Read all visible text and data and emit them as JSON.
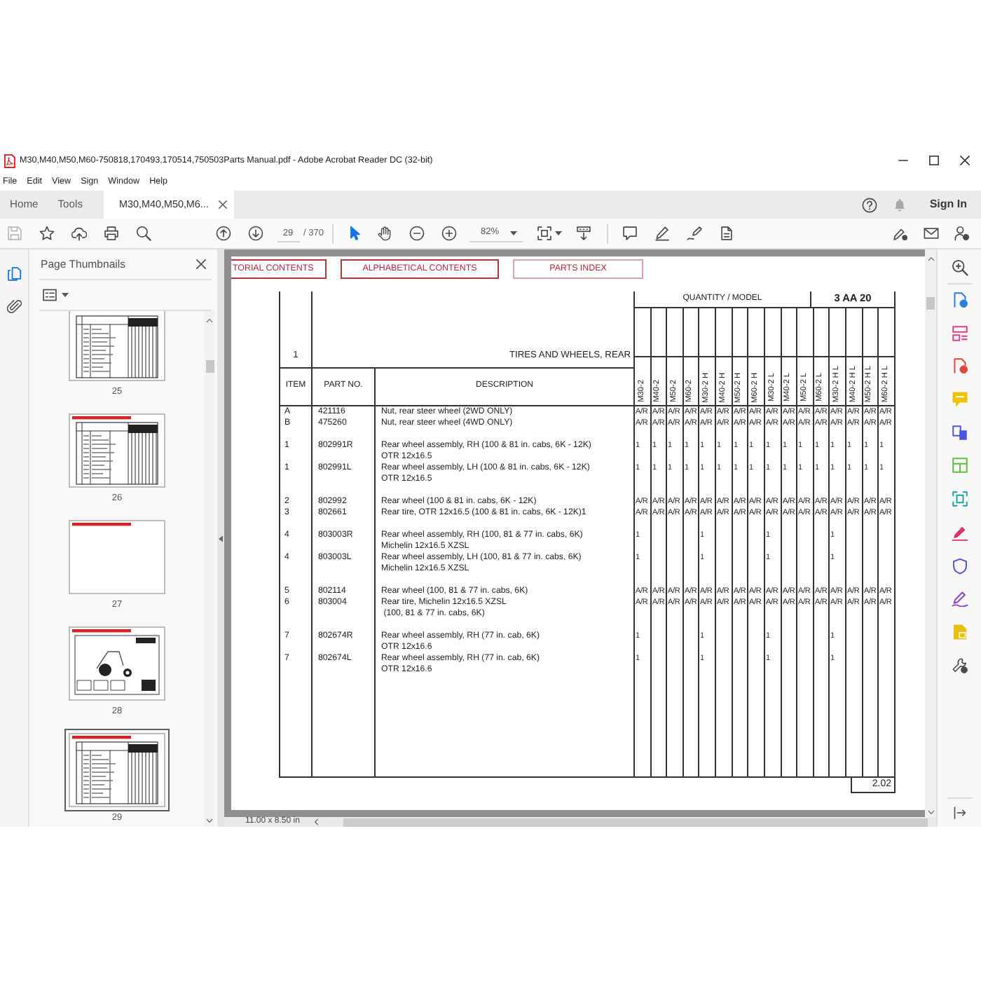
{
  "window": {
    "title": "M30,M40,M50,M60-750818,170493,170514,750503Parts Manual.pdf - Adobe Acrobat Reader DC (32-bit)"
  },
  "menu": [
    "File",
    "Edit",
    "View",
    "Sign",
    "Window",
    "Help"
  ],
  "tabs": [
    {
      "label": "Home",
      "kind": "nav",
      "selected": false
    },
    {
      "label": "Tools",
      "kind": "nav",
      "selected": false
    },
    {
      "label": "M30,M40,M50,M6...",
      "kind": "document",
      "selected": true
    }
  ],
  "account": {
    "sign_in": "Sign In"
  },
  "toolbar": {
    "page": "29",
    "page_total": "/ 370",
    "zoom": "82%"
  },
  "thumbnails_panel": {
    "title": "Page Thumbnails",
    "thumbnails": [
      {
        "label": "25",
        "kind": "table",
        "selected": false
      },
      {
        "label": "26",
        "kind": "table",
        "header_bar": true,
        "selected": false
      },
      {
        "label": "27",
        "kind": "blank",
        "header_bar": true,
        "selected": false
      },
      {
        "label": "28",
        "kind": "diagram",
        "header_bar": true,
        "selected": false
      },
      {
        "label": "29",
        "kind": "table",
        "header_bar": true,
        "selected": true
      }
    ]
  },
  "document": {
    "nav_buttons": [
      {
        "label": "TORIAL CONTENTS",
        "color": "#b5343f",
        "cut_off": true
      },
      {
        "label": "ALPHABETICAL CONTENTS",
        "color": "#b5343f",
        "cut_off": false
      },
      {
        "label": "PARTS INDEX",
        "color": "#e4a3aa",
        "cut_off": false
      }
    ],
    "parts_table": {
      "section_number": "1",
      "section_title": "TIRES AND WHEELS, REAR",
      "quantity_heading": "QUANTITY / MODEL",
      "group_code": "3 AA 20",
      "columns": [
        "ITEM",
        "PART NO.",
        "DESCRIPTION"
      ],
      "models": [
        "M30-2",
        "M40-2",
        "M50-2",
        "M60-2",
        "M30-2 H",
        "M40-2 H",
        "M50-2 H",
        "M60-2 H",
        "M30-2 L",
        "M40-2 L",
        "M50-2 L",
        "M60-2 L",
        "M30-2 H L",
        "M40-2 H L",
        "M50-2 H L",
        "M60-2 H L"
      ],
      "row_groups": [
        [
          {
            "item": "A",
            "part_no": "421116",
            "description": "Nut, rear steer wheel (2WD ONLY)",
            "quantities": [
              "A/R",
              "A/R",
              "A/R",
              "A/R",
              "A/R",
              "A/R",
              "A/R",
              "A/R",
              "A/R",
              "A/R",
              "A/R",
              "A/R",
              "A/R",
              "A/R",
              "A/R",
              "A/R"
            ]
          },
          {
            "item": "B",
            "part_no": "475260",
            "description": "Nut, rear steer wheel (4WD ONLY)",
            "quantities": [
              "A/R",
              "A/R",
              "A/R",
              "A/R",
              "A/R",
              "A/R",
              "A/R",
              "A/R",
              "A/R",
              "A/R",
              "A/R",
              "A/R",
              "A/R",
              "A/R",
              "A/R",
              "A/R"
            ]
          }
        ],
        [
          {
            "item": "1",
            "part_no": "802991R",
            "description": "Rear wheel assembly, RH (100 & 81 in. cabs, 6K - 12K)\nOTR 12x16.5",
            "quantities": [
              "1",
              "1",
              "1",
              "1",
              "1",
              "1",
              "1",
              "1",
              "1",
              "1",
              "1",
              "1",
              "1",
              "1",
              "1",
              "1"
            ]
          },
          {
            "item": "1",
            "part_no": "802991L",
            "description": "Rear wheel assembly, LH (100 & 81 in. cabs, 6K - 12K)\nOTR 12x16.5",
            "quantities": [
              "1",
              "1",
              "1",
              "1",
              "1",
              "1",
              "1",
              "1",
              "1",
              "1",
              "1",
              "1",
              "1",
              "1",
              "1",
              "1"
            ]
          }
        ],
        [
          {
            "item": "2",
            "part_no": "802992",
            "description": "Rear wheel (100 & 81 in. cabs, 6K - 12K)",
            "quantities": [
              "A/R",
              "A/R",
              "A/R",
              "A/R",
              "A/R",
              "A/R",
              "A/R",
              "A/R",
              "A/R",
              "A/R",
              "A/R",
              "A/R",
              "A/R",
              "A/R",
              "A/R",
              "A/R"
            ]
          },
          {
            "item": "3",
            "part_no": "802661",
            "description": "Rear tire, OTR 12x16.5 (100 & 81 in. cabs, 6K - 12K)1",
            "quantities": [
              "A/R",
              "A/R",
              "A/R",
              "A/R",
              "A/R",
              "A/R",
              "A/R",
              "A/R",
              "A/R",
              "A/R",
              "A/R",
              "A/R",
              "A/R",
              "A/R",
              "A/R",
              "A/R"
            ]
          }
        ],
        [
          {
            "item": "4",
            "part_no": "803003R",
            "description": "Rear wheel assembly, RH (100, 81 & 77 in. cabs, 6K)\nMichelin 12x16.5 XZSL",
            "quantities": [
              "1",
              {
                "kind": "blank"
              },
              {
                "kind": "blank"
              },
              {
                "kind": "blank"
              },
              "1",
              {
                "kind": "blank"
              },
              {
                "kind": "blank"
              },
              {
                "kind": "blank"
              },
              "1",
              {
                "kind": "blank"
              },
              {
                "kind": "blank"
              },
              {
                "kind": "blank"
              },
              "1",
              {
                "kind": "blank"
              },
              {
                "kind": "blank"
              },
              {
                "kind": "blank"
              }
            ]
          },
          {
            "item": "4",
            "part_no": "803003L",
            "description": "Rear wheel assembly, LH (100, 81 & 77 in. cabs, 6K)\nMichelin 12x16.5 XZSL",
            "quantities": [
              "1",
              {
                "kind": "blank"
              },
              {
                "kind": "blank"
              },
              {
                "kind": "blank"
              },
              "1",
              {
                "kind": "blank"
              },
              {
                "kind": "blank"
              },
              {
                "kind": "blank"
              },
              "1",
              {
                "kind": "blank"
              },
              {
                "kind": "blank"
              },
              {
                "kind": "blank"
              },
              "1",
              {
                "kind": "blank"
              },
              {
                "kind": "blank"
              },
              {
                "kind": "blank"
              }
            ]
          }
        ],
        [
          {
            "item": "5",
            "part_no": "802114",
            "description": "Rear wheel (100, 81 & 77 in. cabs, 6K)",
            "quantities": [
              "A/R",
              "A/R",
              "A/R",
              "A/R",
              "A/R",
              "A/R",
              "A/R",
              "A/R",
              "A/R",
              "A/R",
              "A/R",
              "A/R",
              "A/R",
              "A/R",
              "A/R",
              "A/R"
            ]
          },
          {
            "item": "6",
            "part_no": "803004",
            "description": "Rear tire, Michelin 12x16.5 XZSL\n (100, 81 & 77 in. cabs, 6K)",
            "quantities": [
              "A/R",
              "A/R",
              "A/R",
              "A/R",
              "A/R",
              "A/R",
              "A/R",
              "A/R",
              "A/R",
              "A/R",
              "A/R",
              "A/R",
              "A/R",
              "A/R",
              "A/R",
              "A/R"
            ]
          }
        ],
        [
          {
            "item": "7",
            "part_no": "802674R",
            "description": "Rear wheel assembly, RH (77 in. cab, 6K)\nOTR 12x16.6",
            "quantities": [
              "1",
              {
                "kind": "blank"
              },
              {
                "kind": "blank"
              },
              {
                "kind": "blank"
              },
              "1",
              {
                "kind": "blank"
              },
              {
                "kind": "blank"
              },
              {
                "kind": "blank"
              },
              "1",
              {
                "kind": "blank"
              },
              {
                "kind": "blank"
              },
              {
                "kind": "blank"
              },
              "1",
              {
                "kind": "blank"
              },
              {
                "kind": "blank"
              },
              {
                "kind": "blank"
              }
            ]
          },
          {
            "item": "7",
            "part_no": "802674L",
            "description": "Rear wheel assembly, RH (77 in. cab, 6K)\nOTR 12x16.6",
            "quantities": [
              "1",
              {
                "kind": "blank"
              },
              {
                "kind": "blank"
              },
              {
                "kind": "blank"
              },
              "1",
              {
                "kind": "blank"
              },
              {
                "kind": "blank"
              },
              {
                "kind": "blank"
              },
              "1",
              {
                "kind": "blank"
              },
              {
                "kind": "blank"
              },
              {
                "kind": "blank"
              },
              "1",
              {
                "kind": "blank"
              },
              {
                "kind": "blank"
              },
              {
                "kind": "blank"
              }
            ]
          }
        ]
      ]
    },
    "page_number": "2.02"
  },
  "status_bar": {
    "page_size": "11.00 x 8.50 in"
  }
}
